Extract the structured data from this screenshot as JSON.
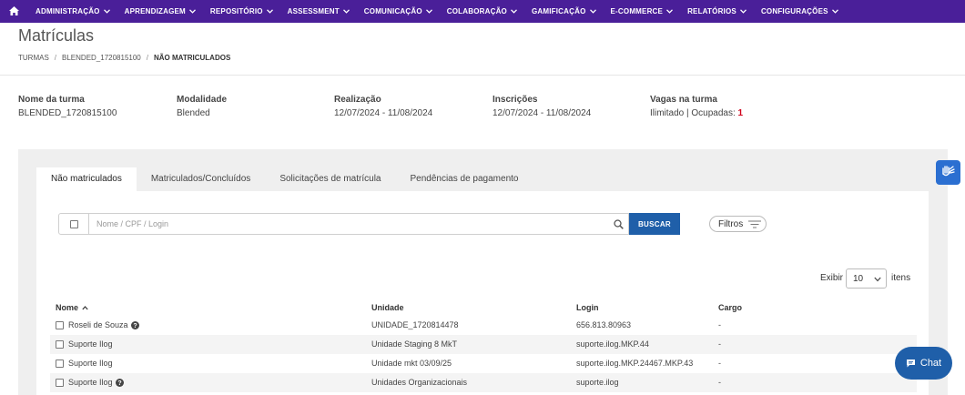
{
  "nav": {
    "items": [
      {
        "label": "ADMINISTRAÇÃO"
      },
      {
        "label": "APRENDIZAGEM"
      },
      {
        "label": "REPOSITÓRIO"
      },
      {
        "label": "ASSESSMENT"
      },
      {
        "label": "COMUNICAÇÃO"
      },
      {
        "label": "COLABORAÇÃO"
      },
      {
        "label": "GAMIFICAÇÃO"
      },
      {
        "label": "E-COMMERCE"
      },
      {
        "label": "RELATÓRIOS"
      },
      {
        "label": "CONFIGURAÇÕES"
      }
    ],
    "home_icon": "home-icon",
    "bg_color": "#4a1f99"
  },
  "page": {
    "title": "Matrículas"
  },
  "breadcrumb": {
    "items": [
      "TURMAS",
      "BLENDED_1720815100",
      "NÃO MATRICULADOS"
    ],
    "separator": "/"
  },
  "info": {
    "nome_label": "Nome da turma",
    "nome_value": "BLENDED_1720815100",
    "modalidade_label": "Modalidade",
    "modalidade_value": "Blended",
    "realizacao_label": "Realização",
    "realizacao_value": "12/07/2024 - 11/08/2024",
    "inscricoes_label": "Inscrições",
    "inscricoes_value": "12/07/2024 - 11/08/2024",
    "vagas_label": "Vagas na turma",
    "vagas_value": "Ilimitado | Ocupadas:",
    "vagas_ocupadas": "1"
  },
  "tabs": [
    {
      "label": "Não matriculados",
      "active": true
    },
    {
      "label": "Matriculados/Concluídos",
      "active": false
    },
    {
      "label": "Solicitações de matrícula",
      "active": false
    },
    {
      "label": "Pendências de pagamento",
      "active": false
    }
  ],
  "search": {
    "placeholder": "Nome / CPF / Login",
    "value": "",
    "button_label": "BUSCAR",
    "filtros_label": "Filtros"
  },
  "pagination": {
    "exibir_label": "Exibir",
    "selected": "10",
    "itens_label": "itens"
  },
  "table": {
    "headers": {
      "nome": "Nome",
      "unidade": "Unidade",
      "login": "Login",
      "cargo": "Cargo"
    },
    "rows": [
      {
        "nome": "Roseli de Souza",
        "info_icon": true,
        "unidade": "UNIDADE_1720814478",
        "login": "656.813.80963",
        "cargo": "-"
      },
      {
        "nome": "Suporte Ilog",
        "info_icon": false,
        "unidade": "Unidade Staging 8 MkT",
        "login": "suporte.ilog.MKP.44",
        "cargo": "-"
      },
      {
        "nome": "Suporte Ilog",
        "info_icon": false,
        "unidade": "Unidade mkt 03/09/25",
        "login": "suporte.ilog.MKP.24467.MKP.43",
        "cargo": "-"
      },
      {
        "nome": "Suporte Ilog",
        "info_icon": true,
        "unidade": "Unidades Organizacionais",
        "login": "suporte.ilog",
        "cargo": "-"
      }
    ]
  },
  "chat": {
    "label": "Chat"
  },
  "colors": {
    "primary": "#1f5fa9",
    "accent_red": "#d0021b",
    "accessibility": "#2b6fd1"
  }
}
